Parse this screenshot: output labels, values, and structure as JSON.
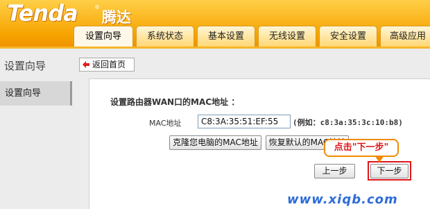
{
  "header": {
    "logo": "Tenda",
    "logo_cn": "腾达",
    "reg_mark": "®"
  },
  "tabs": [
    {
      "label": "设置向导",
      "active": true
    },
    {
      "label": "系统状态",
      "active": false
    },
    {
      "label": "基本设置",
      "active": false
    },
    {
      "label": "无线设置",
      "active": false
    },
    {
      "label": "安全设置",
      "active": false
    },
    {
      "label": "高级应用",
      "active": false
    }
  ],
  "sidebar": {
    "title": "设置向导",
    "home_button": "返回首页",
    "items": [
      {
        "label": "设置向导",
        "selected": true
      }
    ]
  },
  "main": {
    "heading": "设置路由器WAN口的MAC地址 ：",
    "mac_label": "MAC地址",
    "mac_value": "C8:3A:35:51:EF:55",
    "mac_hint": "(例如：c8:3a:35:3c:10:b8)",
    "clone_button": "克隆您电脑的MAC地址",
    "restore_button": "恢复默认的MAC地址",
    "prev_button": "上一步",
    "next_button": "下一步"
  },
  "annotation": {
    "callout": "点击\"下一步\"",
    "color": "#e0161b"
  },
  "watermark": "www.xiqb.com",
  "colors": {
    "header_orange": "#f7a300",
    "callout_border": "#f08a00",
    "watermark_blue": "#2e6cd8"
  }
}
